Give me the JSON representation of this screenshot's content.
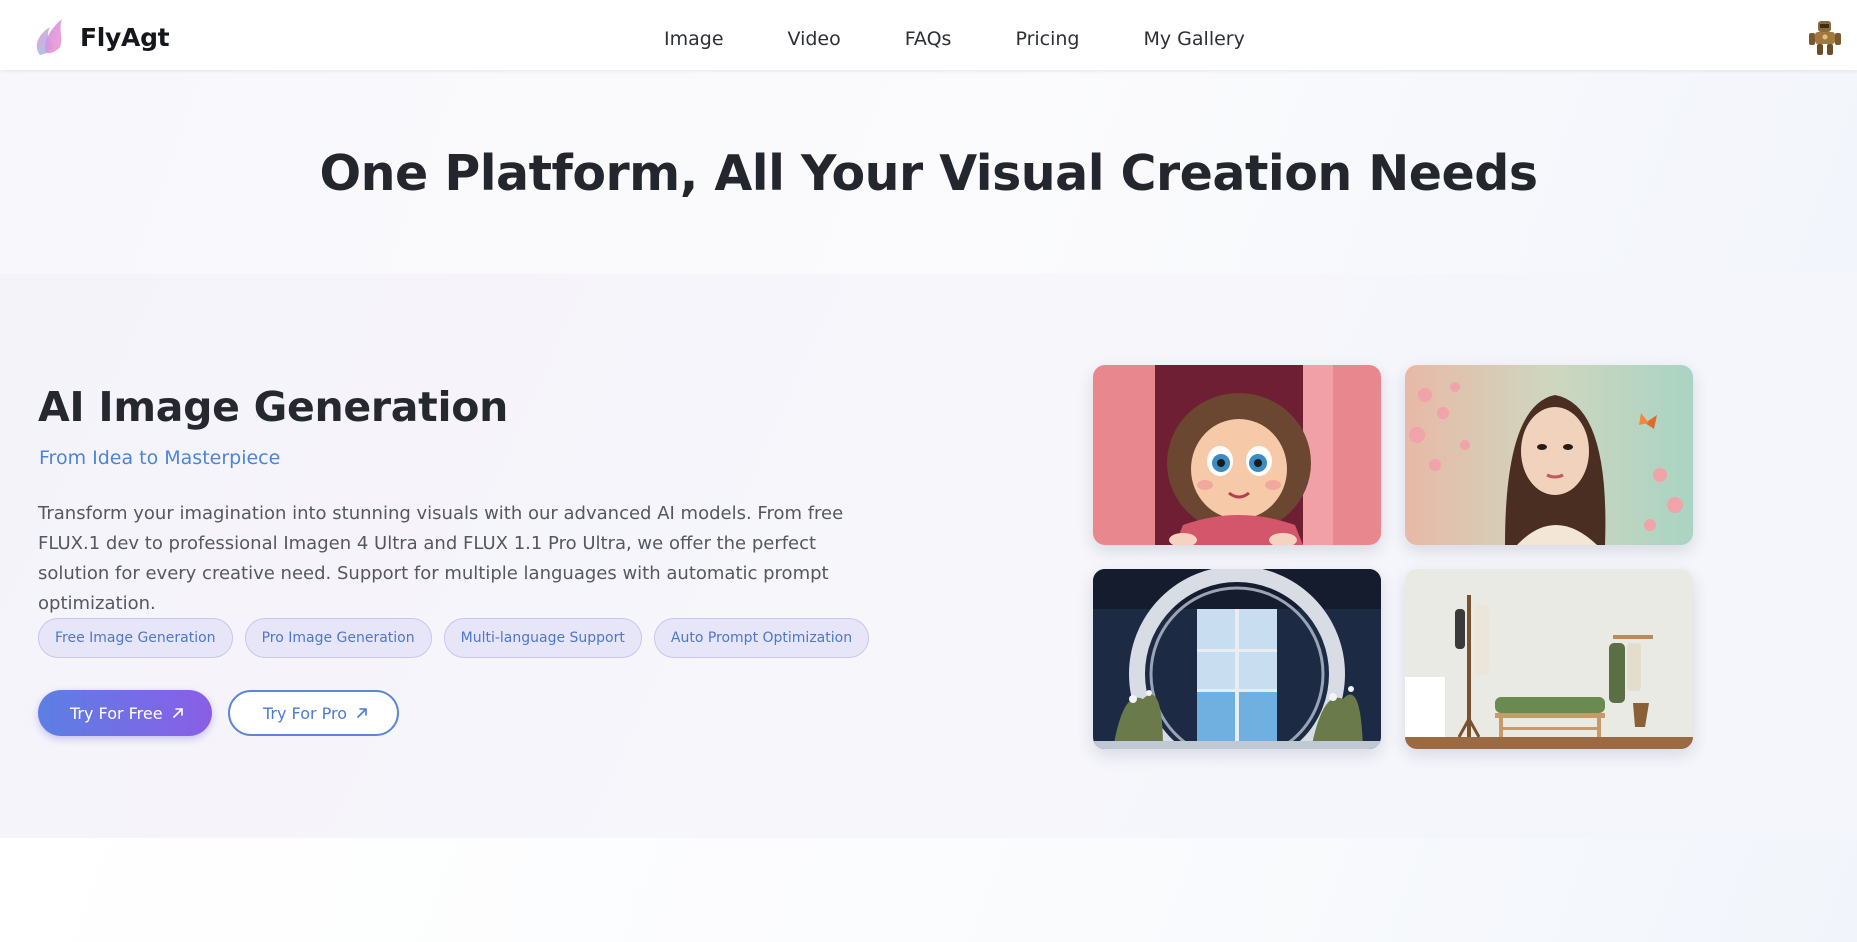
{
  "header": {
    "brand_name": "FlyAgt",
    "nav": [
      "Image",
      "Video",
      "FAQs",
      "Pricing",
      "My Gallery"
    ]
  },
  "hero": {
    "title": "One Platform, All Your Visual Creation Needs"
  },
  "feature": {
    "title": "AI Image Generation",
    "subtitle": "From Idea to Masterpiece",
    "description": "Transform your imagination into stunning visuals with our advanced AI models. From free FLUX.1 dev to professional Imagen 4 Ultra and FLUX 1.1 Pro Ultra, we offer the perfect solution for every creative need. Support for multiple languages with automatic prompt optimization.",
    "tags": [
      "Free Image Generation",
      "Pro Image Generation",
      "Multi-language Support",
      "Auto Prompt Optimization"
    ],
    "buttons": {
      "free": "Try For Free",
      "pro": "Try For Pro"
    },
    "gallery": [
      {
        "subject": "cartoon-girl"
      },
      {
        "subject": "woman-blossoms"
      },
      {
        "subject": "winter-arch-window"
      },
      {
        "subject": "hallway-bench-rack"
      }
    ]
  },
  "colors": {
    "accent": "#4a86d6",
    "button_gradient_start": "#5c7fe4",
    "button_gradient_end": "#8a5ee6",
    "tag_bg": "#e6e6f8"
  }
}
